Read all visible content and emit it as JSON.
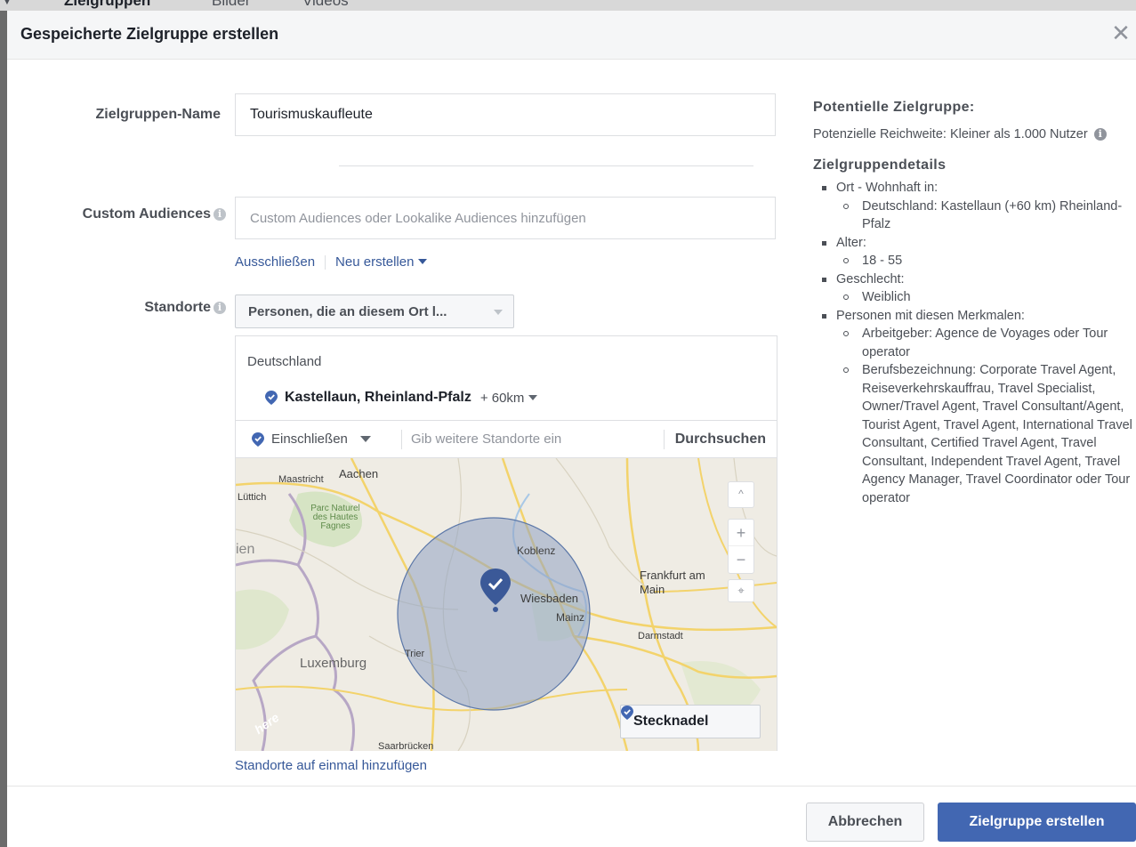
{
  "background_tabs": [
    "Zielgruppen",
    "Bilder",
    "Videos"
  ],
  "modal": {
    "title": "Gespeicherte Zielgruppe erstellen",
    "close_icon": "close-icon"
  },
  "form": {
    "name_label": "Zielgruppen-Name",
    "name_value": "Tourismuskaufleute",
    "custom_label": "Custom Audiences",
    "custom_placeholder": "Custom Audiences oder Lookalike Audiences hinzufügen",
    "exclude_link": "Ausschließen",
    "new_link": "Neu erstellen",
    "locations_label": "Standorte",
    "locations_dropdown": "Personen, die an diesem Ort l...",
    "country": "Deutschland",
    "city": "Kastellaun, Rheinland-Pfalz",
    "radius": "+ 60km",
    "include_select": "Einschließen",
    "location_placeholder": "Gib weitere Standorte ein",
    "search_button": "Durchsuchen",
    "pin_button": "Stecknadel",
    "bulk_link": "Standorte auf einmal hinzufügen",
    "map_labels": {
      "aachen": "Aachen",
      "maastricht": "Maastricht",
      "luettich": "Lüttich",
      "fagnes": "Parc Naturel des Hautes Fagnes",
      "ien": "ien",
      "koblenz": "Koblenz",
      "frankfurt": "Frankfurt am Main",
      "wiesbaden": "Wiesbaden",
      "mainz": "Mainz",
      "darmstadt": "Darmstadt",
      "luxemburg": "Luxemburg",
      "trier": "Trier",
      "saarbruecken": "Saarbrücken",
      "here": "here"
    },
    "zoom_in": "+",
    "zoom_out": "−"
  },
  "summary": {
    "title": "Potentielle Zielgruppe:",
    "reach": "Potenzielle Reichweite: Kleiner als 1.000 Nutzer",
    "details_title": "Zielgruppendetails",
    "items": [
      {
        "label": "Ort - Wohnhaft in:",
        "sub": [
          "Deutschland: Kastellaun (+60 km) Rheinland-Pfalz"
        ]
      },
      {
        "label": "Alter:",
        "sub": [
          "18 - 55"
        ]
      },
      {
        "label": "Geschlecht:",
        "sub": [
          "Weiblich"
        ]
      },
      {
        "label": "Personen mit diesen Merkmalen:",
        "sub": [
          "Arbeitgeber: Agence de Voyages oder Tour operator",
          "Berufsbezeichnung: Corporate Travel Agent, Reiseverkehrskauffrau, Travel Specialist, Owner/Travel Agent, Travel Consultant/Agent, Tourist Agent, Travel Agent, International Travel Consultant, Certified Travel Agent, Travel Consultant, Independent Travel Agent, Travel Agency Manager, Travel Coordinator oder Tour operator"
        ]
      }
    ]
  },
  "footer": {
    "cancel": "Abbrechen",
    "create": "Zielgruppe erstellen"
  },
  "colors": {
    "primary": "#4267b2",
    "link": "#365899",
    "radius_fill": "#8fa3c2",
    "pin": "#3b5998"
  }
}
